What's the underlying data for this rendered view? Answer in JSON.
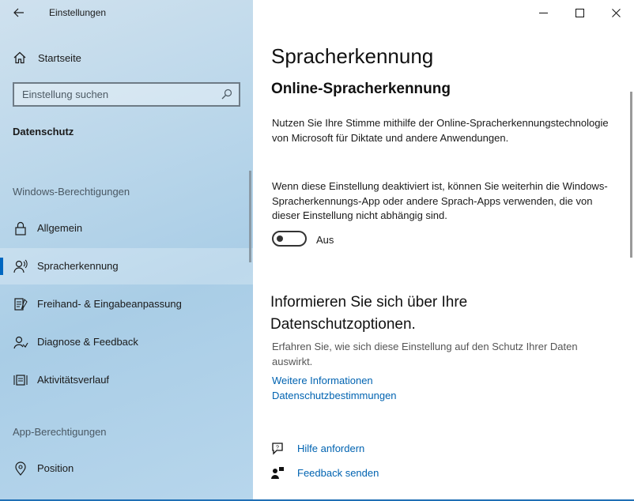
{
  "app": {
    "title": "Einstellungen"
  },
  "sidebar": {
    "home_label": "Startseite",
    "search_placeholder": "Einstellung suchen",
    "category": "Datenschutz",
    "section_windows": "Windows-Berechtigungen",
    "windows_items": [
      {
        "label": "Allgemein",
        "icon": "lock-icon"
      },
      {
        "label": "Spracherkennung",
        "icon": "speech-person-icon",
        "selected": true
      },
      {
        "label": "Freihand- & Eingabeanpassung",
        "icon": "inking-typing-icon"
      },
      {
        "label": "Diagnose & Feedback",
        "icon": "diagnostics-person-icon"
      },
      {
        "label": "Aktivitätsverlauf",
        "icon": "activity-history-icon"
      }
    ],
    "section_apps": "App-Berechtigungen",
    "app_items": [
      {
        "label": "Position",
        "icon": "location-pin-icon"
      }
    ]
  },
  "main": {
    "page_title": "Spracherkennung",
    "sub_title": "Online-Spracherkennung",
    "para1": "Nutzen Sie Ihre Stimme mithilfe der Online-Spracherkennungstechnologie von Microsoft für Diktate und andere Anwendungen.",
    "para2": "Wenn diese Einstellung deaktiviert ist, können Sie weiterhin die Windows-Spracherkennungs-App oder andere Sprach-Apps verwenden, die von dieser Einstellung nicht abhängig sind.",
    "toggle_label": "Aus",
    "toggle_on": false,
    "info_heading": "Informieren Sie sich über Ihre Datenschutzoptionen.",
    "info_desc": "Erfahren Sie, wie sich diese Einstellung auf den Schutz Ihrer Daten auswirkt.",
    "link_more": "Weitere Informationen",
    "link_privacy": "Datenschutzbestimmungen",
    "help_label": "Hilfe anfordern",
    "feedback_label": "Feedback senden"
  },
  "colors": {
    "accent": "#0067c0",
    "link": "#0063b1"
  }
}
